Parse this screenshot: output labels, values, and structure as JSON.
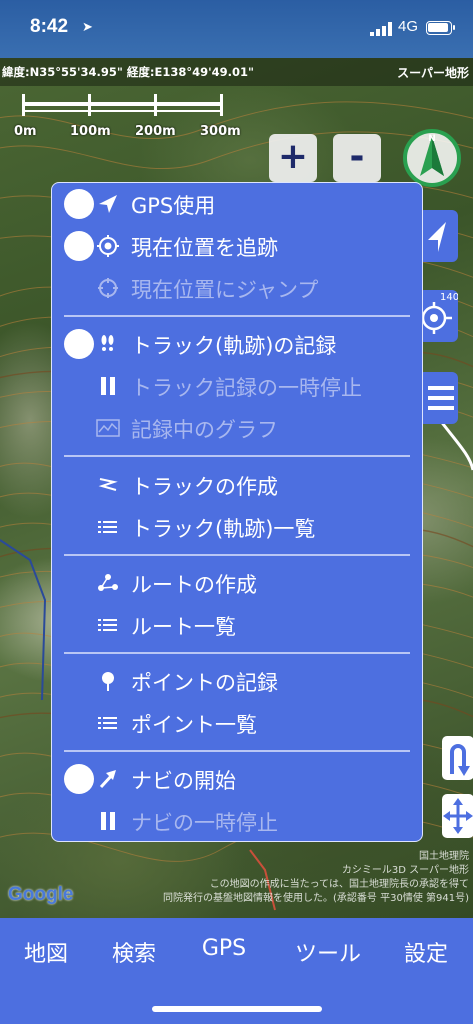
{
  "status_bar": {
    "time": "8:42",
    "network": "4G"
  },
  "coord_bar": {
    "coordinates": "緯度:N35°55'34.95\" 経度:E138°49'49.01\"",
    "map_type": "スーパー地形"
  },
  "scale": {
    "labels": [
      "0m",
      "100m",
      "200m",
      "300m"
    ]
  },
  "zoom": {
    "in_label": "+",
    "out_label": "-"
  },
  "right_controls": {
    "badge": "140"
  },
  "menu": {
    "items": [
      {
        "label": "GPS使用",
        "icon": "location-arrow-icon",
        "toggle": true,
        "enabled": true
      },
      {
        "label": "現在位置を追跡",
        "icon": "crosshair-icon",
        "toggle": true,
        "enabled": true
      },
      {
        "label": "現在位置にジャンプ",
        "icon": "jump-target-icon",
        "toggle": false,
        "enabled": false
      },
      {
        "label": "トラック(軌跡)の記録",
        "icon": "footprints-icon",
        "toggle": true,
        "enabled": true
      },
      {
        "label": "トラック記録の一時停止",
        "icon": "pause-icon",
        "toggle": false,
        "enabled": false
      },
      {
        "label": "記録中のグラフ",
        "icon": "graph-icon",
        "toggle": false,
        "enabled": false
      },
      {
        "label": "トラックの作成",
        "icon": "track-create-icon",
        "toggle": false,
        "enabled": true
      },
      {
        "label": "トラック(軌跡)一覧",
        "icon": "list-icon",
        "toggle": false,
        "enabled": true
      },
      {
        "label": "ルートの作成",
        "icon": "route-create-icon",
        "toggle": false,
        "enabled": true
      },
      {
        "label": "ルート一覧",
        "icon": "list-icon",
        "toggle": false,
        "enabled": true
      },
      {
        "label": "ポイントの記録",
        "icon": "map-pin-icon",
        "toggle": false,
        "enabled": true
      },
      {
        "label": "ポイント一覧",
        "icon": "list-icon",
        "toggle": false,
        "enabled": true
      },
      {
        "label": "ナビの開始",
        "icon": "navigate-arrow-icon",
        "toggle": true,
        "enabled": true
      },
      {
        "label": "ナビの一時停止",
        "icon": "pause-icon",
        "toggle": false,
        "enabled": false
      }
    ]
  },
  "map": {
    "logo": "Google",
    "attribution_line1": "国土地理院",
    "attribution_line2": "カシミール3D スーパー地形",
    "attribution_line3": "この地図の作成に当たっては、国土地理院長の承認を得て",
    "attribution_line4": "同院発行の基盤地図情報を使用した。(承認番号 平30情使 第941号)"
  },
  "tab_bar": {
    "tabs": [
      "地図",
      "検索",
      "GPS",
      "ツール",
      "設定"
    ]
  },
  "colors": {
    "accent": "#4d6fe0",
    "status_bar": "#2b5ea3",
    "disabled_text": "#a8b7ef"
  }
}
